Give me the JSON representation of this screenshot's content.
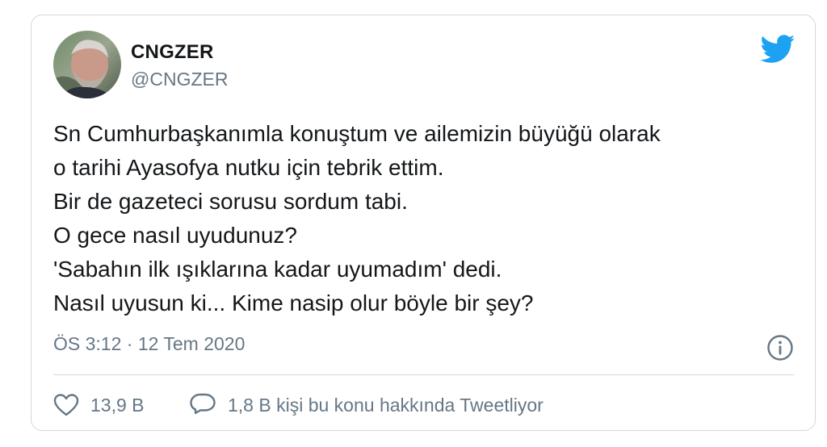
{
  "user": {
    "display_name": "CNGZER",
    "handle": "@CNGZER",
    "avatar_icon": "avatar-photo"
  },
  "brand": {
    "icon": "twitter-bird-icon",
    "color": "#1da1f2"
  },
  "tweet": {
    "lines": [
      "Sn Cumhurbaşkanımla konuştum ve ailemizin büyüğü olarak",
      "o tarihi Ayasofya nutku için tebrik ettim.",
      "Bir de gazeteci sorusu sordum tabi.",
      "O gece nasıl uyudunuz?",
      "'Sabahın ilk ışıklarına kadar uyumadım' dedi.",
      "Nasıl uyusun ki... Kime nasip olur böyle bir şey?"
    ],
    "timestamp": "ÖS 3:12 · 12 Tem 2020"
  },
  "actions": {
    "likes": "13,9 B",
    "replies_text": "1,8 B kişi bu konu hakkında Tweetliyor"
  },
  "colors": {
    "text": "#14171a",
    "secondary": "#657786",
    "border": "#cfd9de"
  }
}
